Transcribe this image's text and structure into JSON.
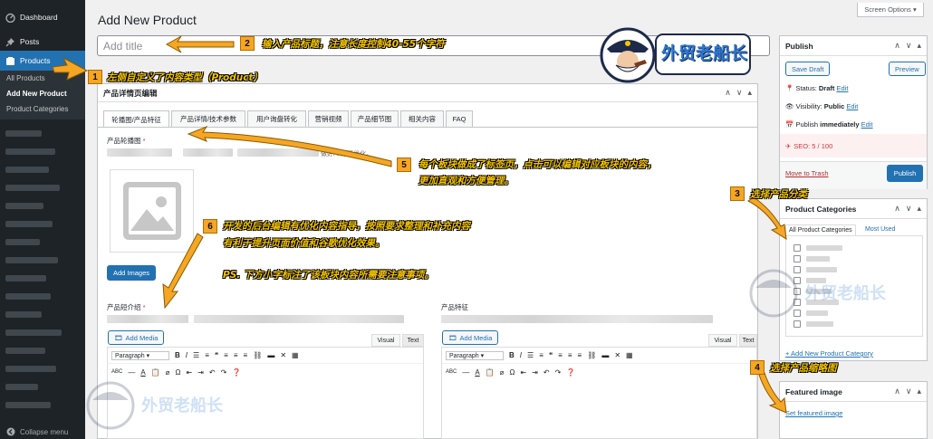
{
  "sidebar": {
    "dashboard": "Dashboard",
    "posts": "Posts",
    "products": "Products",
    "submenu": [
      "All Products",
      "Add New Product",
      "Product Categories"
    ],
    "collapse": "Collapse menu"
  },
  "header": {
    "title": "Add New Product",
    "screen_options": "Screen Options ▾",
    "title_placeholder": "Add title"
  },
  "editor_box": {
    "title": "产品详情页编辑",
    "tabs": [
      "轮播图/产品特征",
      "产品详情/技术参数",
      "用户询盘转化",
      "营销视频",
      "产品细节图",
      "相关内容",
      "FAQ"
    ],
    "gallery_label": "产品轮播图",
    "required": "*",
    "hint_alt": "做好Alt标签优化。",
    "add_images": "Add Images",
    "short_desc_label": "产品短介绍",
    "features_label": "产品特征",
    "add_media": "Add Media",
    "visual": "Visual",
    "text": "Text",
    "paragraph": "Paragraph"
  },
  "publish": {
    "title": "Publish",
    "save_draft": "Save Draft",
    "preview": "Preview",
    "status_label": "Status:",
    "status_value": "Draft",
    "visibility_label": "Visibility:",
    "visibility_value": "Public",
    "publish_label": "Publish",
    "publish_value": "immediately",
    "edit": "Edit",
    "seo": "SEO: 5 / 100",
    "trash": "Move to Trash",
    "publish_btn": "Publish"
  },
  "categories": {
    "title": "Product Categories",
    "tab_all": "All Product Categories",
    "tab_most": "Most Used",
    "add_new": "+ Add New Product Category"
  },
  "featured": {
    "title": "Featured image",
    "set": "Set featured image"
  },
  "annotations": {
    "n1": "1",
    "t1": "左侧自定义了内容类型（Product）",
    "n2": "2",
    "t2": "输入产品标题，注意长度控制40-55个字符",
    "n3": "3",
    "t3": "选择产品分类",
    "n4": "4",
    "t4": "选择产品缩略图",
    "n5": "5",
    "t5a": "每个板块做成了标签页，点击可以编辑对应板块的内容，",
    "t5b": "更加直观和方便管理。",
    "n6": "6",
    "t6a": "开发的后台编辑有优化内容指导，按照要求整理和补充内容",
    "t6b": "有利于提升页面价值和谷歌优化效果。",
    "t6c": "PS. 下方小字标注了该板块内容所需要注意事项。"
  },
  "logo": {
    "text": "外贸老船长"
  },
  "colors": {
    "accent": "#2271b1",
    "sidebar": "#1d2327",
    "annotation": "#f5c400",
    "badge": "#f5a623",
    "seo": "#d63638"
  }
}
